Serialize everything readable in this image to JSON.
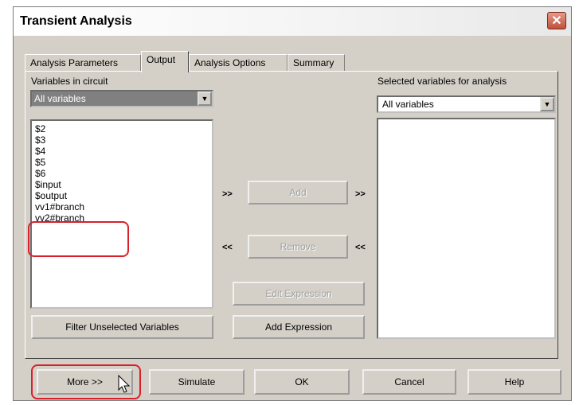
{
  "window": {
    "title": "Transient Analysis",
    "close_glyph": "✕"
  },
  "tabs": [
    {
      "label": "Analysis Parameters"
    },
    {
      "label": "Output"
    },
    {
      "label": "Analysis Options"
    },
    {
      "label": "Summary"
    }
  ],
  "left": {
    "label": "Variables in circuit",
    "filter_value": "All variables",
    "variables": [
      "$2",
      "$3",
      "$4",
      "$5",
      "$6",
      "$input",
      "$output",
      "vv1#branch",
      "vv2#branch"
    ],
    "filter_button": "Filter Unselected Variables"
  },
  "middle": {
    "add_left": ">>",
    "add_label": "Add",
    "add_right": ">>",
    "remove_left": "<<",
    "remove_label": "Remove",
    "remove_right": "<<",
    "edit_expression": "Edit Expression",
    "add_expression": "Add Expression"
  },
  "right": {
    "label": "Selected variables for analysis",
    "filter_value": "All variables"
  },
  "footer": {
    "more": "More >>",
    "simulate": "Simulate",
    "ok": "OK",
    "cancel": "Cancel",
    "help": "Help"
  },
  "colors": {
    "highlight": "#d9202a",
    "dialog": "#d4d0c8"
  }
}
